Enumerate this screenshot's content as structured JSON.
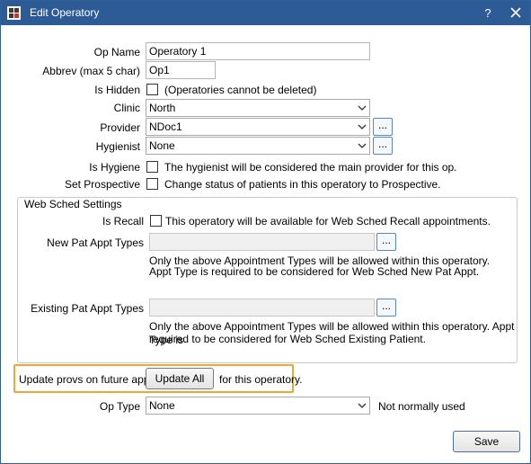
{
  "window": {
    "title": "Edit Operatory",
    "help_label": "?"
  },
  "fields": {
    "op_name": {
      "label": "Op Name",
      "value": "Operatory 1"
    },
    "abbrev": {
      "label": "Abbrev (max 5 char)",
      "value": "Op1"
    },
    "is_hidden": {
      "label": "Is Hidden",
      "note": "(Operatories cannot be deleted)",
      "checked": false
    },
    "clinic": {
      "label": "Clinic",
      "value": "North"
    },
    "provider": {
      "label": "Provider",
      "value": "NDoc1",
      "button": "..."
    },
    "hygienist": {
      "label": "Hygienist",
      "value": "None",
      "button": "..."
    },
    "is_hygiene": {
      "label": "Is Hygiene",
      "note": "The hygienist will be considered the main provider for this op.",
      "checked": false
    },
    "set_prospective": {
      "label": "Set Prospective",
      "note": "Change status of patients in this operatory to Prospective.",
      "checked": false
    }
  },
  "web_sched": {
    "title": "Web Sched Settings",
    "is_recall": {
      "label": "Is Recall",
      "note": "This operatory will be available for Web Sched Recall appointments.",
      "checked": false
    },
    "new_pat": {
      "label": "New Pat Appt Types",
      "button": "...",
      "note_line1": "Only the above Appointment Types will be allowed within this operatory.",
      "note_line2": "Appt Type is required to be considered for Web Sched New Pat Appt."
    },
    "existing_pat": {
      "label": "Existing Pat Appt Types",
      "button": "...",
      "note_line1": "Only the above Appointment Types will be allowed within this operatory. Appt Type is",
      "note_line2": "required to be considered for Web Sched Existing Patient."
    }
  },
  "update_provs": {
    "label_before": "Update provs on future appts",
    "button": "Update All",
    "label_after": "for this operatory."
  },
  "op_type": {
    "label": "Op Type",
    "value": "None",
    "note": "Not normally used"
  },
  "save_button": "Save",
  "colors": {
    "titlebar": "#2c5b95",
    "highlight": "#f0a534"
  }
}
